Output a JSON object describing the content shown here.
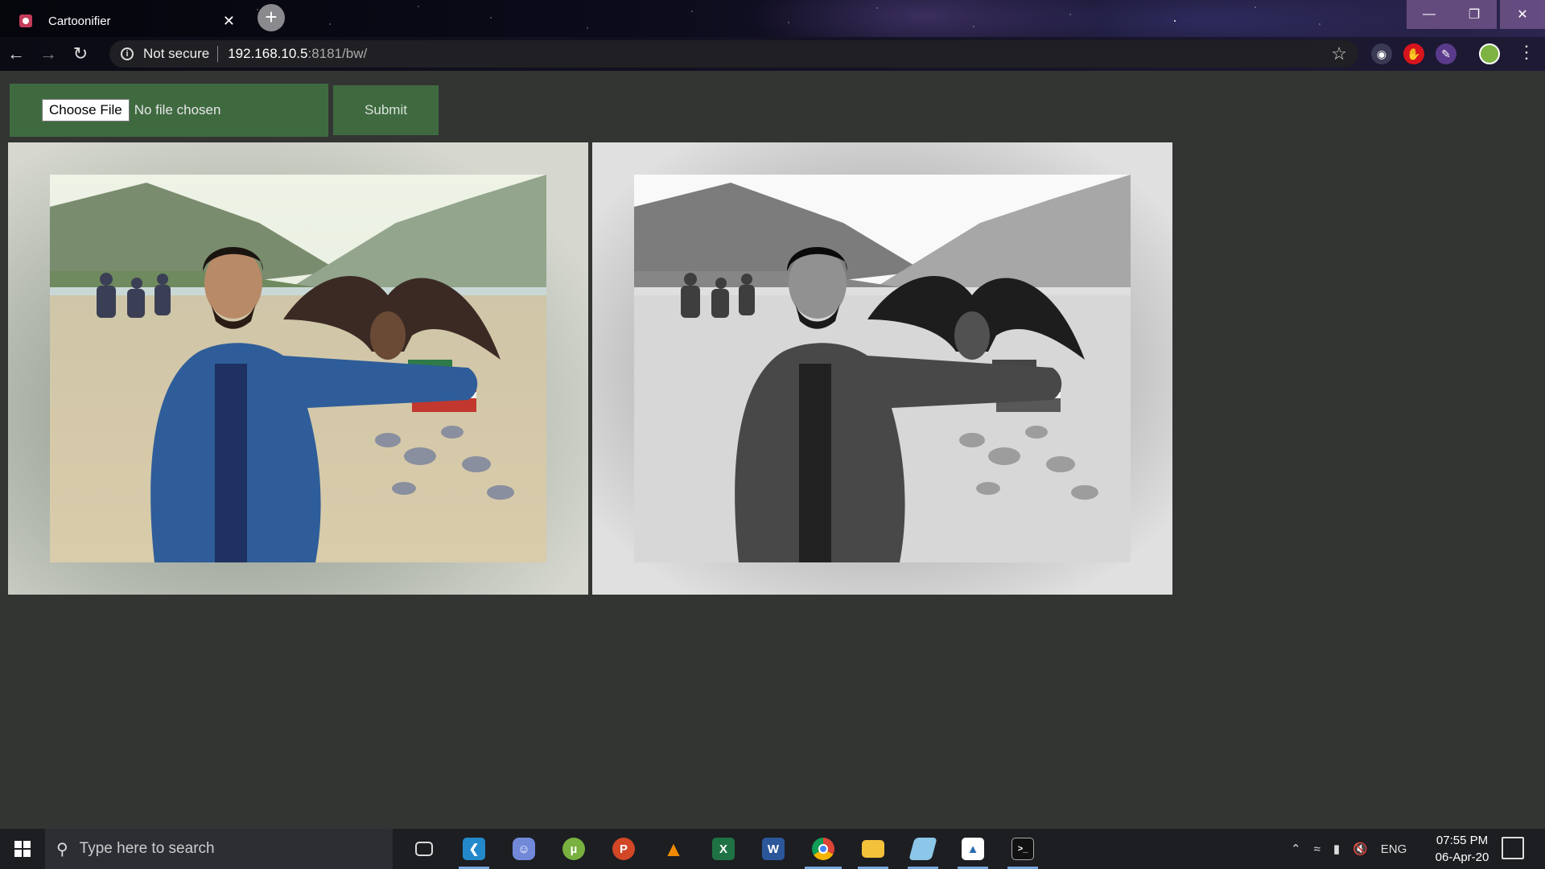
{
  "browser": {
    "tab_title": "Cartoonifier",
    "tab_close": "✕",
    "new_tab": "+",
    "security_label": "Not secure",
    "url_host": "192.168.10.5",
    "url_rest": ":8181/bw/"
  },
  "form": {
    "choose_file_label": "Choose File",
    "file_status": "No file chosen",
    "submit_label": "Submit"
  },
  "images": {
    "original_label": "original-photo",
    "processed_label": "black-white-photo"
  },
  "taskbar": {
    "search_placeholder": "Type here to search",
    "apps": [
      "task-view",
      "vscode",
      "discord",
      "utorrent",
      "powerpoint",
      "vlc",
      "excel",
      "word",
      "chrome",
      "file-explorer",
      "notepad-like",
      "photos",
      "terminal"
    ],
    "tray_language": "ENG",
    "time": "07:55 PM",
    "date": "06-Apr-20"
  },
  "colors": {
    "page_bg": "#333533",
    "form_green": "#3f6a40"
  }
}
